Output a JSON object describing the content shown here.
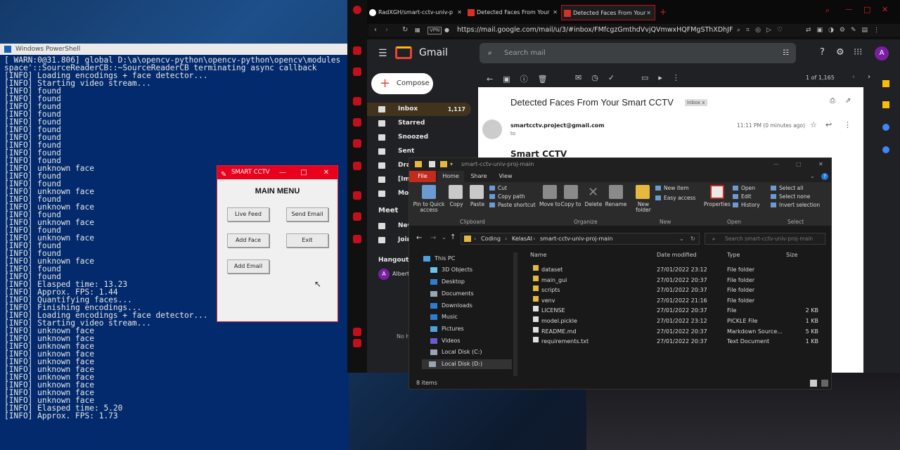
{
  "powershell": {
    "title": "Windows PowerShell",
    "lines": [
      "[ WARN:0@31.806] global D:\\a\\opencv-python\\opencv-python\\opencv\\modules",
      "space'::SourceReaderCB::~SourceReaderCB terminating async callback",
      "[INFO] Loading encodings + face detector...",
      "[INFO] Starting video stream...",
      "[INFO] found",
      "[INFO] found",
      "[INFO] found",
      "[INFO] found",
      "[INFO] found",
      "[INFO] found",
      "[INFO] found",
      "[INFO] found",
      "[INFO] found",
      "[INFO] found",
      "[INFO] unknown face",
      "[INFO] found",
      "[INFO] found",
      "[INFO] unknown face",
      "[INFO] found",
      "[INFO] unknown face",
      "[INFO] found",
      "[INFO] unknown face",
      "[INFO] found",
      "[INFO] unknown face",
      "[INFO] found",
      "[INFO] found",
      "[INFO] unknown face",
      "[INFO] found",
      "[INFO] found",
      "[INFO] Elasped time: 13.23",
      "[INFO] Approx. FPS: 1.44",
      "[INFO] Quantifying faces...",
      "[INFO] Finishing encodings...",
      "[INFO] Loading encodings + face detector...",
      "[INFO] Starting video stream...",
      "[INFO] unknown face",
      "[INFO] unknown face",
      "[INFO] unknown face",
      "[INFO] unknown face",
      "[INFO] unknown face",
      "[INFO] unknown face",
      "[INFO] unknown face",
      "[INFO] unknown face",
      "[INFO] unknown face",
      "[INFO] unknown face",
      "[INFO] Elasped time: 5.20",
      "[INFO] Approx. FPS: 1.73"
    ]
  },
  "cctv": {
    "title": "SMART CCTV",
    "heading": "MAIN MENU",
    "buttons": {
      "live": "Live Feed",
      "send": "Send Email",
      "add_face": "Add Face",
      "exit": "Exit",
      "add_email": "Add Email"
    }
  },
  "browser": {
    "tabs": [
      "RadXGH/smart-cctv-univ-p",
      "Detected Faces From Your",
      "Detected Faces From Your"
    ],
    "vpn": "VPN",
    "url": "https://mail.google.com/mail/u/3/#inbox/FMfcgzGmthdVvjQVmwxHQFMgSThXDhJF"
  },
  "gmail": {
    "logo": "Gmail",
    "search_placeholder": "Search mail",
    "avatar": "A",
    "compose": "Compose",
    "nav": [
      {
        "label": "Inbox",
        "count": "1,117"
      },
      {
        "label": "Starred",
        "count": ""
      },
      {
        "label": "Snoozed",
        "count": ""
      },
      {
        "label": "Sent",
        "count": ""
      },
      {
        "label": "Draft",
        "count": ""
      },
      {
        "label": "[Imap",
        "count": ""
      },
      {
        "label": "More",
        "count": ""
      }
    ],
    "meet": "Meet",
    "meet_new": "New",
    "meet_join": "Join",
    "hangouts": "Hangouts",
    "hangouts_user": "Albert",
    "hangouts_avatar": "A",
    "no_hint": "No H",
    "pagination": "1 of 1,165",
    "subject": "Detected Faces From Your Smart CCTV",
    "label": "Inbox",
    "label_close": "x",
    "sender": "smartcctv.project@gmail.com",
    "to": "to",
    "time": "11:11 PM (0 minutes ago)",
    "body_heading": "Smart CCTV"
  },
  "explorer": {
    "title": "smart-cctv-univ-proj-main",
    "ribbon_tabs": [
      "File",
      "Home",
      "Share",
      "View"
    ],
    "ribbon": {
      "pin": "Pin to Quick access",
      "copy": "Copy",
      "paste": "Paste",
      "cut": "Cut",
      "copy_path": "Copy path",
      "paste_shortcut": "Paste shortcut",
      "move_to": "Move to",
      "copy_to": "Copy to",
      "delete": "Delete",
      "rename": "Rename",
      "new_folder": "New folder",
      "new_item": "New item",
      "easy_access": "Easy access",
      "properties": "Properties",
      "open": "Open",
      "edit": "Edit",
      "history": "History",
      "select_all": "Select all",
      "select_none": "Select none",
      "invert": "Invert selection",
      "groups": [
        "Clipboard",
        "Organize",
        "New",
        "Open",
        "Select"
      ]
    },
    "path": [
      "Coding",
      "KelasAI",
      "smart-cctv-univ-proj-main"
    ],
    "search_placeholder": "Search smart-cctv-univ-proj-main",
    "nav": [
      "This PC",
      "3D Objects",
      "Desktop",
      "Documents",
      "Downloads",
      "Music",
      "Pictures",
      "Videos",
      "Local Disk (C:)",
      "Local Disk (D:)"
    ],
    "columns": {
      "name": "Name",
      "date": "Date modified",
      "type": "Type",
      "size": "Size"
    },
    "files": [
      {
        "name": "dataset",
        "date": "27/01/2022 23:12",
        "type": "File folder",
        "size": "",
        "kind": "folder"
      },
      {
        "name": "main_gui",
        "date": "27/01/2022 20:37",
        "type": "File folder",
        "size": "",
        "kind": "folder"
      },
      {
        "name": "scripts",
        "date": "27/01/2022 20:37",
        "type": "File folder",
        "size": "",
        "kind": "folder"
      },
      {
        "name": "venv",
        "date": "27/01/2022 21:16",
        "type": "File folder",
        "size": "",
        "kind": "folder"
      },
      {
        "name": "LICENSE",
        "date": "27/01/2022 20:37",
        "type": "File",
        "size": "2 KB",
        "kind": "file"
      },
      {
        "name": "model.pickle",
        "date": "27/01/2022 23:12",
        "type": "PICKLE File",
        "size": "1 KB",
        "kind": "file"
      },
      {
        "name": "README.md",
        "date": "27/01/2022 20:37",
        "type": "Markdown Source...",
        "size": "5 KB",
        "kind": "file"
      },
      {
        "name": "requirements.txt",
        "date": "27/01/2022 20:37",
        "type": "Text Document",
        "size": "1 KB",
        "kind": "file"
      }
    ],
    "status": "8 items"
  },
  "colors": {
    "ps_bg": "#022a6c",
    "cctv_title": "#e8001c",
    "opera_red": "#c0101e",
    "gmail_bg": "#202124"
  }
}
